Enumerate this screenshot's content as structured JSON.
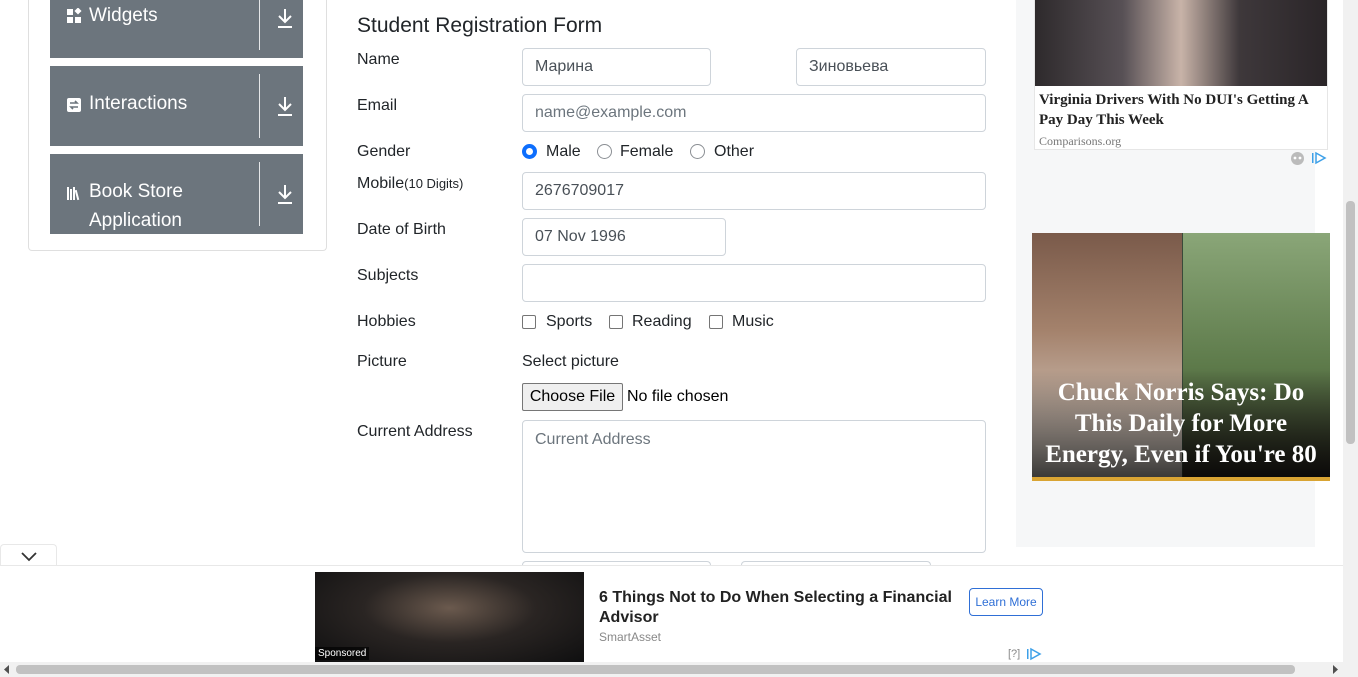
{
  "sidebar": {
    "groups": [
      {
        "label": "Widgets",
        "icon": "widgets-icon"
      },
      {
        "label": "Interactions",
        "icon": "interactions-icon"
      },
      {
        "label_line1": "Book Store",
        "label_line2": "Application",
        "icon": "book-store-icon"
      }
    ]
  },
  "form": {
    "title": "Student Registration Form",
    "name_label": "Name",
    "first_name_value": "Марина",
    "last_name_value": "Зиновьева",
    "email_label": "Email",
    "email_placeholder": "name@example.com",
    "gender_label": "Gender",
    "gender_options": [
      "Male",
      "Female",
      "Other"
    ],
    "gender_selected": "Male",
    "mobile_label": "Mobile",
    "mobile_hint": "(10 Digits)",
    "mobile_value": "2676709017",
    "dob_label": "Date of Birth",
    "dob_value": "07 Nov 1996",
    "subjects_label": "Subjects",
    "subjects_value": "",
    "hobbies_label": "Hobbies",
    "hobbies_options": [
      "Sports",
      "Reading",
      "Music"
    ],
    "picture_label": "Picture",
    "picture_caption": "Select picture",
    "choose_file_label": "Choose File",
    "file_status": "No file chosen",
    "address_label": "Current Address",
    "address_placeholder": "Current Address"
  },
  "ads": {
    "ad1_title": "Virginia Drivers With No DUI's Getting A Pay Day This Week",
    "ad1_source": "Comparisons.org",
    "ad2_title": "Chuck Norris Says: Do This Daily for More Energy, Even if You're 80",
    "bottom_title": "6 Things Not to Do When Selecting a Financial Advisor",
    "bottom_source": "SmartAsset",
    "bottom_cta": "Learn More",
    "bottom_sponsored": "Sponsored",
    "bottom_info": "[?]"
  },
  "colors": {
    "sidebar_bg": "#6c757d",
    "primary": "#0d6efd",
    "ad_cta": "#2f6fd6"
  }
}
